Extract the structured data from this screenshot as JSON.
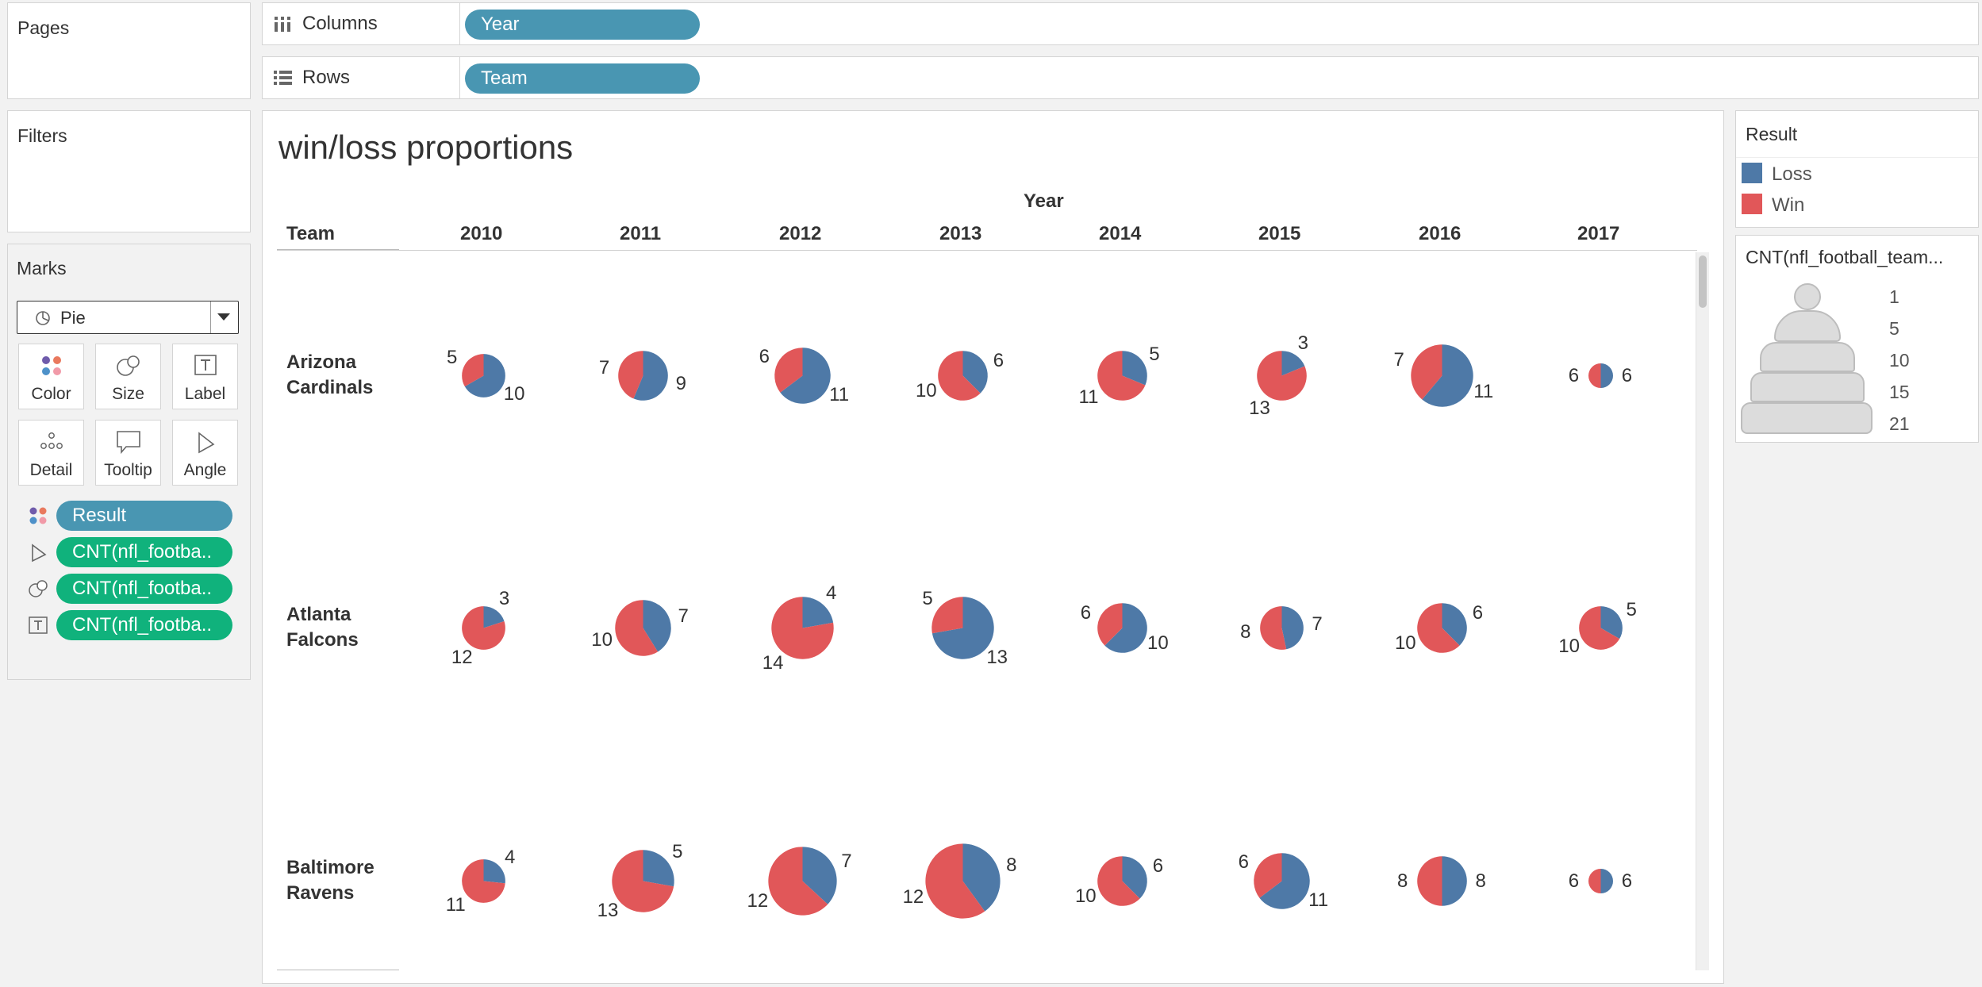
{
  "pages": {
    "title": "Pages"
  },
  "filters": {
    "title": "Filters"
  },
  "columns_shelf": {
    "label": "Columns",
    "pill": "Year"
  },
  "rows_shelf": {
    "label": "Rows",
    "pill": "Team"
  },
  "marks": {
    "title": "Marks",
    "mark_type": "Pie",
    "buttons": [
      "Color",
      "Size",
      "Label",
      "Detail",
      "Tooltip",
      "Angle"
    ],
    "fields": [
      {
        "icon": "color-dots-icon",
        "label": "Result",
        "color": "#4996b2"
      },
      {
        "icon": "angle-icon",
        "label": "CNT(nfl_footba..",
        "color": "#10b27c"
      },
      {
        "icon": "size-icon",
        "label": "CNT(nfl_footba..",
        "color": "#10b27c"
      },
      {
        "icon": "label-icon",
        "label": "CNT(nfl_footba..",
        "color": "#10b27c"
      }
    ]
  },
  "view": {
    "title": "win/loss proportions",
    "column_header": "Year",
    "row_header": "Team"
  },
  "color_legend": {
    "title": "Result",
    "items": [
      {
        "label": "Loss",
        "color": "#4e79a7"
      },
      {
        "label": "Win",
        "color": "#e15759"
      }
    ]
  },
  "size_legend": {
    "title": "CNT(nfl_football_team...",
    "values": [
      "1",
      "5",
      "10",
      "15",
      "21"
    ]
  },
  "chart_data": {
    "type": "pie",
    "layout": "small multiples (Team rows × Year columns)",
    "categories": [
      "2010",
      "2011",
      "2012",
      "2013",
      "2014",
      "2015",
      "2016",
      "2017"
    ],
    "slice_order": [
      "Loss",
      "Win"
    ],
    "colors": {
      "Loss": "#4e79a7",
      "Win": "#e15759"
    },
    "rows": [
      {
        "team": "Arizona Cardinals",
        "name_lines": [
          "Arizona",
          "Cardinals"
        ],
        "loss": [
          10,
          9,
          11,
          6,
          5,
          3,
          11,
          6
        ],
        "win": [
          5,
          7,
          6,
          10,
          11,
          13,
          7,
          6
        ]
      },
      {
        "team": "Atlanta Falcons",
        "name_lines": [
          "Atlanta",
          "Falcons"
        ],
        "loss": [
          3,
          7,
          4,
          13,
          10,
          7,
          6,
          5
        ],
        "win": [
          12,
          10,
          14,
          5,
          6,
          8,
          10,
          10
        ]
      },
      {
        "team": "Baltimore Ravens",
        "name_lines": [
          "Baltimore",
          "Ravens"
        ],
        "loss": [
          4,
          5,
          7,
          8,
          6,
          11,
          8,
          6
        ],
        "win": [
          11,
          13,
          12,
          12,
          10,
          6,
          8,
          6
        ]
      }
    ]
  }
}
